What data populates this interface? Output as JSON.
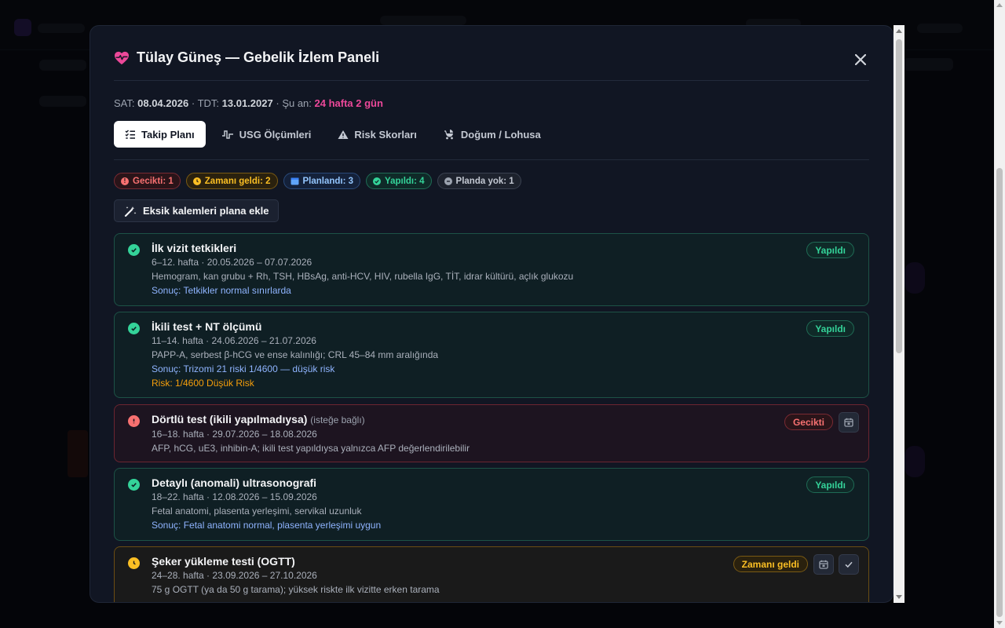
{
  "modal": {
    "title": "Tülay Güneş — Gebelik İzlem Paneli",
    "close_icon": "close-icon"
  },
  "dates": {
    "sat_label": "SAT:",
    "sat_value": "08.04.2026",
    "sep1": "·",
    "tdt_label": "TDT:",
    "tdt_value": "13.01.2027",
    "sep2": "·",
    "now_label": "Şu an:",
    "now_value": "24 hafta 2 gün"
  },
  "tabs": [
    {
      "label": "Takip Planı",
      "icon": "checklist-icon",
      "active": true
    },
    {
      "label": "USG Ölçümleri",
      "icon": "pulse-icon",
      "active": false
    },
    {
      "label": "Risk Skorları",
      "icon": "warning-icon",
      "active": false
    },
    {
      "label": "Doğum / Lohusa",
      "icon": "stroller-icon",
      "active": false
    }
  ],
  "badges": [
    {
      "label": "Gecikti: 1",
      "icon": "alert-icon",
      "color": "#f87171"
    },
    {
      "label": "Zamanı geldi: 2",
      "icon": "clock-icon",
      "color": "#fbbf24"
    },
    {
      "label": "Planlandı: 3",
      "icon": "calendar-icon",
      "color": "#60a5fa"
    },
    {
      "label": "Yapıldı: 4",
      "icon": "check-icon",
      "color": "#34d399"
    },
    {
      "label": "Planda yok: 1",
      "icon": "minus-icon",
      "color": "#9ca3af"
    }
  ],
  "add_button": {
    "label": "Eksik kalemleri plana ekle",
    "icon": "magic-wand-icon"
  },
  "cards": [
    {
      "title": "İlk vizit tetkikleri",
      "optional": "",
      "period": "6–12. hafta · 20.05.2026 – 07.07.2026",
      "detail": "Hemogram, kan grubu + Rh, TSH, HBsAg, anti-HCV, HIV, rubella IgG, TİT, idrar kültürü, açlık glukozu",
      "result": "Sonuç: Tetkikler normal sınırlarda",
      "risk": "",
      "status": "Yapıldı",
      "state": "done"
    },
    {
      "title": "İkili test + NT ölçümü",
      "optional": "",
      "period": "11–14. hafta · 24.06.2026 – 21.07.2026",
      "detail": "PAPP-A, serbest β-hCG ve ense kalınlığı; CRL 45–84 mm aralığında",
      "result": "Sonuç: Trizomi 21 riski 1/4600 — düşük risk",
      "risk": "Risk: 1/4600 Düşük Risk",
      "status": "Yapıldı",
      "state": "done"
    },
    {
      "title": "Dörtlü test (ikili yapılmadıysa)",
      "optional": "(isteğe bağlı)",
      "period": "16–18. hafta · 29.07.2026 – 18.08.2026",
      "detail": "AFP, hCG, uE3, inhibin-A; ikili test yapıldıysa yalnızca AFP değerlendirilebilir",
      "result": "",
      "risk": "",
      "status": "Gecikti",
      "state": "late"
    },
    {
      "title": "Detaylı (anomali) ultrasonografi",
      "optional": "",
      "period": "18–22. hafta · 12.08.2026 – 15.09.2026",
      "detail": "Fetal anatomi, plasenta yerleşimi, servikal uzunluk",
      "result": "Sonuç: Fetal anatomi normal, plasenta yerleşimi uygun",
      "risk": "",
      "status": "Yapıldı",
      "state": "done"
    },
    {
      "title": "Şeker yükleme testi (OGTT)",
      "optional": "",
      "period": "24–28. hafta · 23.09.2026 – 27.10.2026",
      "detail": "75 g OGTT (ya da 50 g tarama); yüksek riskte ilk vizitte erken tarama",
      "result": "",
      "risk": "",
      "status": "Zamanı geldi",
      "state": "due"
    }
  ]
}
